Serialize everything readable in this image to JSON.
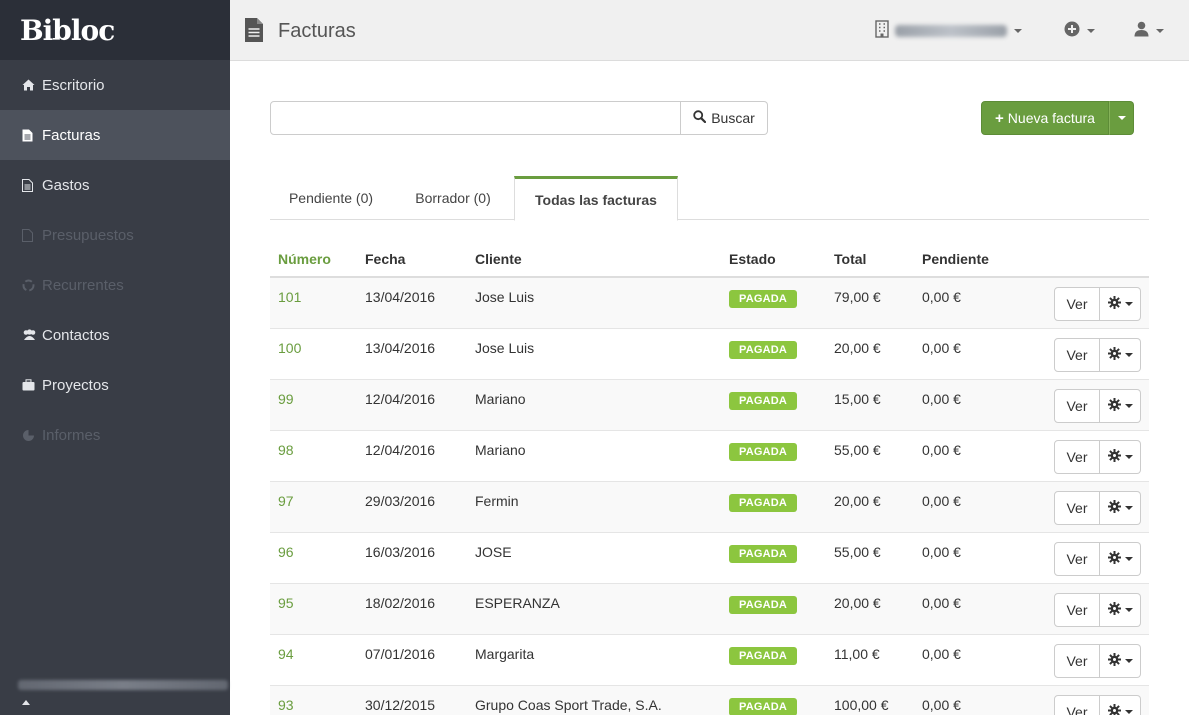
{
  "app": {
    "brand": "Bibloc"
  },
  "sidebar": {
    "items": [
      {
        "label": "Escritorio",
        "icon": "home-icon",
        "state": "normal"
      },
      {
        "label": "Facturas",
        "icon": "document-icon",
        "state": "active"
      },
      {
        "label": "Gastos",
        "icon": "document-icon",
        "state": "normal"
      },
      {
        "label": "Presupuestos",
        "icon": "document-icon",
        "state": "disabled"
      },
      {
        "label": "Recurrentes",
        "icon": "recycle-icon",
        "state": "disabled"
      },
      {
        "label": "Contactos",
        "icon": "users-icon",
        "state": "normal"
      },
      {
        "label": "Proyectos",
        "icon": "briefcase-icon",
        "state": "normal"
      },
      {
        "label": "Informes",
        "icon": "pie-chart-icon",
        "state": "disabled"
      }
    ]
  },
  "header": {
    "title": "Facturas"
  },
  "search": {
    "placeholder": "",
    "value": "",
    "button_label": "Buscar"
  },
  "actions": {
    "new_invoice_label": "Nueva factura"
  },
  "tabs": [
    {
      "label": "Pendiente (0)",
      "active": false
    },
    {
      "label": "Borrador (0)",
      "active": false
    },
    {
      "label": "Todas las facturas",
      "active": true
    }
  ],
  "table": {
    "columns": [
      "Número",
      "Fecha",
      "Cliente",
      "Estado",
      "Total",
      "Pendiente"
    ],
    "rows": [
      {
        "numero": "101",
        "fecha": "13/04/2016",
        "cliente": "Jose Luis",
        "estado": "PAGADA",
        "total": "79,00 €",
        "pendiente": "0,00 €"
      },
      {
        "numero": "100",
        "fecha": "13/04/2016",
        "cliente": "Jose Luis",
        "estado": "PAGADA",
        "total": "20,00 €",
        "pendiente": "0,00 €"
      },
      {
        "numero": "99",
        "fecha": "12/04/2016",
        "cliente": "Mariano",
        "estado": "PAGADA",
        "total": "15,00 €",
        "pendiente": "0,00 €"
      },
      {
        "numero": "98",
        "fecha": "12/04/2016",
        "cliente": "Mariano",
        "estado": "PAGADA",
        "total": "55,00 €",
        "pendiente": "0,00 €"
      },
      {
        "numero": "97",
        "fecha": "29/03/2016",
        "cliente": "Fermin",
        "estado": "PAGADA",
        "total": "20,00 €",
        "pendiente": "0,00 €"
      },
      {
        "numero": "96",
        "fecha": "16/03/2016",
        "cliente": "JOSE",
        "estado": "PAGADA",
        "total": "55,00 €",
        "pendiente": "0,00 €"
      },
      {
        "numero": "95",
        "fecha": "18/02/2016",
        "cliente": "ESPERANZA",
        "estado": "PAGADA",
        "total": "20,00 €",
        "pendiente": "0,00 €"
      },
      {
        "numero": "94",
        "fecha": "07/01/2016",
        "cliente": "Margarita",
        "estado": "PAGADA",
        "total": "11,00 €",
        "pendiente": "0,00 €"
      },
      {
        "numero": "93",
        "fecha": "30/12/2015",
        "cliente": "Grupo Coas Sport Trade, S.A.",
        "estado": "PAGADA",
        "total": "100,00 €",
        "pendiente": "0,00 €"
      }
    ],
    "row_button_label": "Ver"
  },
  "colors": {
    "accent": "#6a9d3f",
    "badge": "#8cc63f",
    "sidebar": "#393d46",
    "sidebar_brand": "#2b2f38"
  }
}
